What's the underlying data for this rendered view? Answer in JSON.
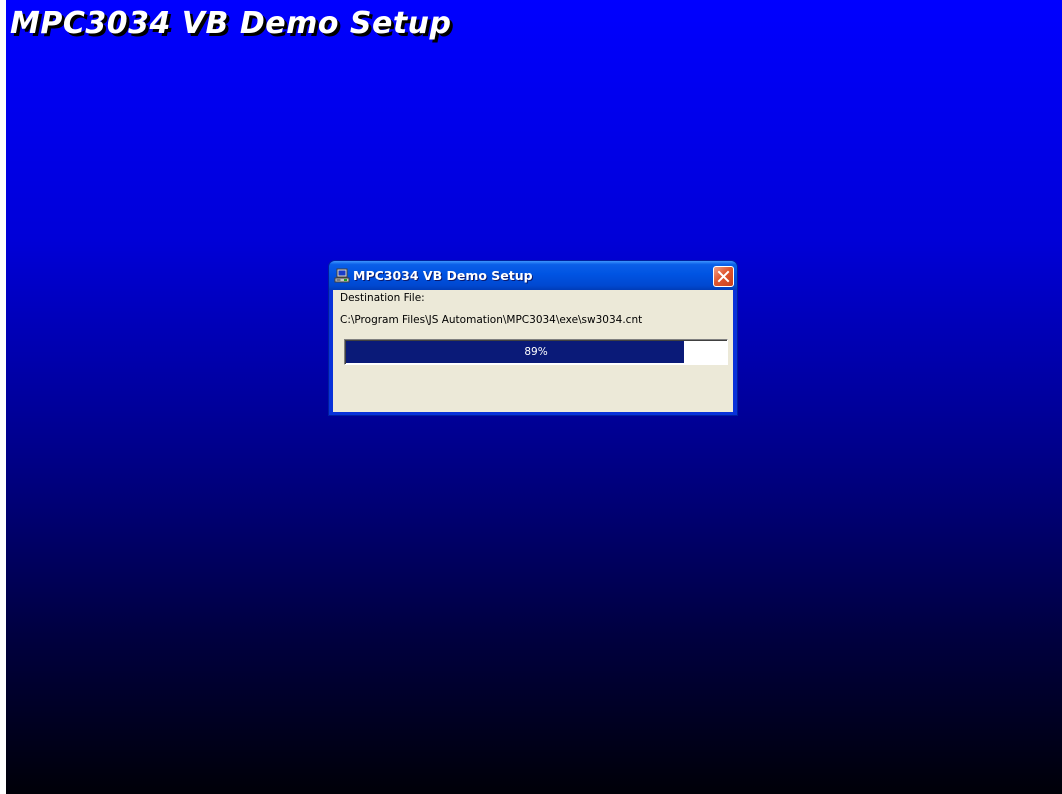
{
  "banner": {
    "title": "MPC3034 VB Demo Setup"
  },
  "dialog": {
    "title": "MPC3034 VB Demo Setup",
    "icon": "setup-computer-icon",
    "close_icon": "close-icon",
    "destination_label": "Destination File:",
    "destination_path": "C:\\Program Files\\JS Automation\\MPC3034\\exe\\sw3034.cnt",
    "progress": {
      "value": 89,
      "label": "89%"
    }
  },
  "colors": {
    "background_top": "#0000ff",
    "background_bottom": "#000008",
    "titlebar": "#0054e3",
    "client": "#ece9d8",
    "progress_fill": "#0a1a78",
    "close_button": "#e0562f"
  }
}
